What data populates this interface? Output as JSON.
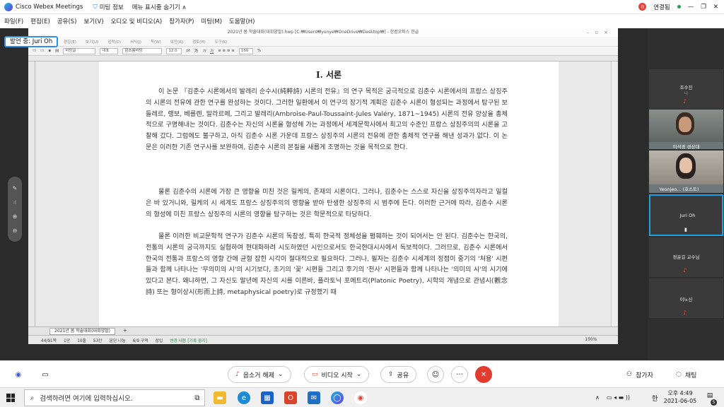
{
  "titlebar": {
    "app_title": "Cisco Webex Meetings",
    "meeting_info": "미팅 정보",
    "menu_toggle": "메뉴 표시줄 숨기기 ∧",
    "connection_badge": "0",
    "connection_status": "연결됨",
    "buttons": [
      "—",
      "❐",
      "✕"
    ]
  },
  "menubar": [
    "파일(F)",
    "편집(E)",
    "공유(S)",
    "보기(V)",
    "오디오 및 비디오(A)",
    "참가자(P)",
    "미팅(M)",
    "도움말(H)"
  ],
  "presenter_badge": "발언 중: Juri Oh",
  "hwp": {
    "window_title": "2021년 봄 학술대회(대회양말).hwp [C:₩Users₩yunye₩OneDrive₩Desktop₩] - 한컴오피스 한글",
    "menu": [
      "편집(E)",
      "보기(U)",
      "입력(D)",
      "서식(J)",
      "쪽(W)",
      "보안(R)",
      "검토(H)",
      "도구(K)"
    ],
    "toolbar": {
      "style": "바탕글",
      "font_type": "대표",
      "font": "함초롬바탕",
      "size": "12.0",
      "unit": "pt",
      "bold": "가",
      "italic": "가",
      "underline": "가",
      "zoom": "160",
      "zoom_unit": "%"
    },
    "heading": "I. 서론",
    "paragraphs": [
      "이 논문 『김춘수 시론에서의 발레리 순수시(純粹詩) 시론의 전유』의 연구 목적은 궁극적으로 김춘수 시론에서의 프랑스 상징주의 시론의 전유에 관한 연구를 완성하는 것이다. 그러한 일환에서 이 연구의 장기적 계획은 김춘수 시론이 형성되는 과정에서 탐구된 보들레르, 랭보, 베를렌, 말라르메, 그리고 발레리(Ambroise-Paul-Toussaint-Jules Valéry, 1871~1945) 시론의 전유 양상을 총체적으로 구명해내는 것이다. 김춘수는 자신의 시론을 형성해 가는 과정에서 세계문학사에서 최고의 수준인 프랑스 상징주의의 시론을 고찰해 갔다. 그럼에도 불구하고, 아직 김춘수 시론 가운데 프랑스 상징주의 시론의 전유에 관한 총체적 연구를 해낸 성과가 없다. 이 논문은 이러한 기존 연구사를 보완하여, 김춘수 시론의 본질을 새롭게 조명하는 것을 목적으로 한다.",
      "물론 김춘수의 시론에 가장 큰 영향을 미친 것은 릴케의, 존재의 시론이다. 그러나, 김춘수는 스스로 자신을 상징주의자라고 일컬은 바 있거니와, 릴케의 시 세계도 프랑스 상징주의의 영향을 받아 탄생한 상징주의 시 범주에 든다. 이러한 근거에 따라, 김춘수 시론의 형성에 미친 프랑스 상징주의 시론의 영향을 탐구하는 것은 학문적으로 타당하다.",
      "물론 이러한 비교문학적 연구가 김춘수 시론의 독창성, 특히 한국적 정체성을 폄훼하는 것이 되어서는 안 된다. 김춘수는 한국의, 전통의 시론의 궁극까지도 실험하여 현대화하려 시도하였던 시인으로서도 한국현대시사에서 독보적이다. 그러므로, 김춘수 시론에서 한국의 전통과 프랑스의 영향 간에 균형 잡힌 시각이 절대적으로 필요하다. 그러나, 필자는 김춘수 시세계의 정점이 중기의 '처용' 시편들과 함께 나타나는 '무의미의 시'의 시기보다, 초기의 '꽃' 시편들 그리고 후기의 '천사' 시편들과 함께 나타나는 '의미의 시'의 시기에 있다고 본다. 왜냐하면, 그 자신도 말년에 자신의 시를 이른바, 플라토닉 포에트리(Platonic Poetry), 시학의 개념으로 관념시(觀念詩) 또는 형이상시(形而上詩, metaphysical poetry)로 규정했기 때"
    ],
    "tab_name": "2021년 봄 학술대회(대회양말)",
    "status": {
      "page": "44/91쪽",
      "section": "1단",
      "line": "10줄",
      "col": "53칸",
      "chars": "문단 나눔",
      "sec": "6/9 구역",
      "mode": "삽입",
      "track": "변경 내용 [기록 중지]",
      "zoom": "150%"
    }
  },
  "participants": [
    {
      "name": "조수진",
      "sub": "나"
    },
    {
      "name": "이석광 경상대",
      "sub": ""
    },
    {
      "name": "Yeonjeo... (호스트)",
      "sub": ""
    },
    {
      "name": "Juri Oh",
      "sub": ""
    },
    {
      "name": "정윤길 교수님",
      "sub": ""
    },
    {
      "name": "이노신",
      "sub": ""
    }
  ],
  "meetbar": {
    "mute": "음소거 해제",
    "video": "비디오 시작",
    "share": "공유",
    "participants": "참가자",
    "chat": "채팅"
  },
  "taskbar": {
    "search_placeholder": "검색하려면 여기에 입력하십시오.",
    "time": "오후 4:49",
    "date": "2021-06-05",
    "ime": "한",
    "notif": "5"
  }
}
